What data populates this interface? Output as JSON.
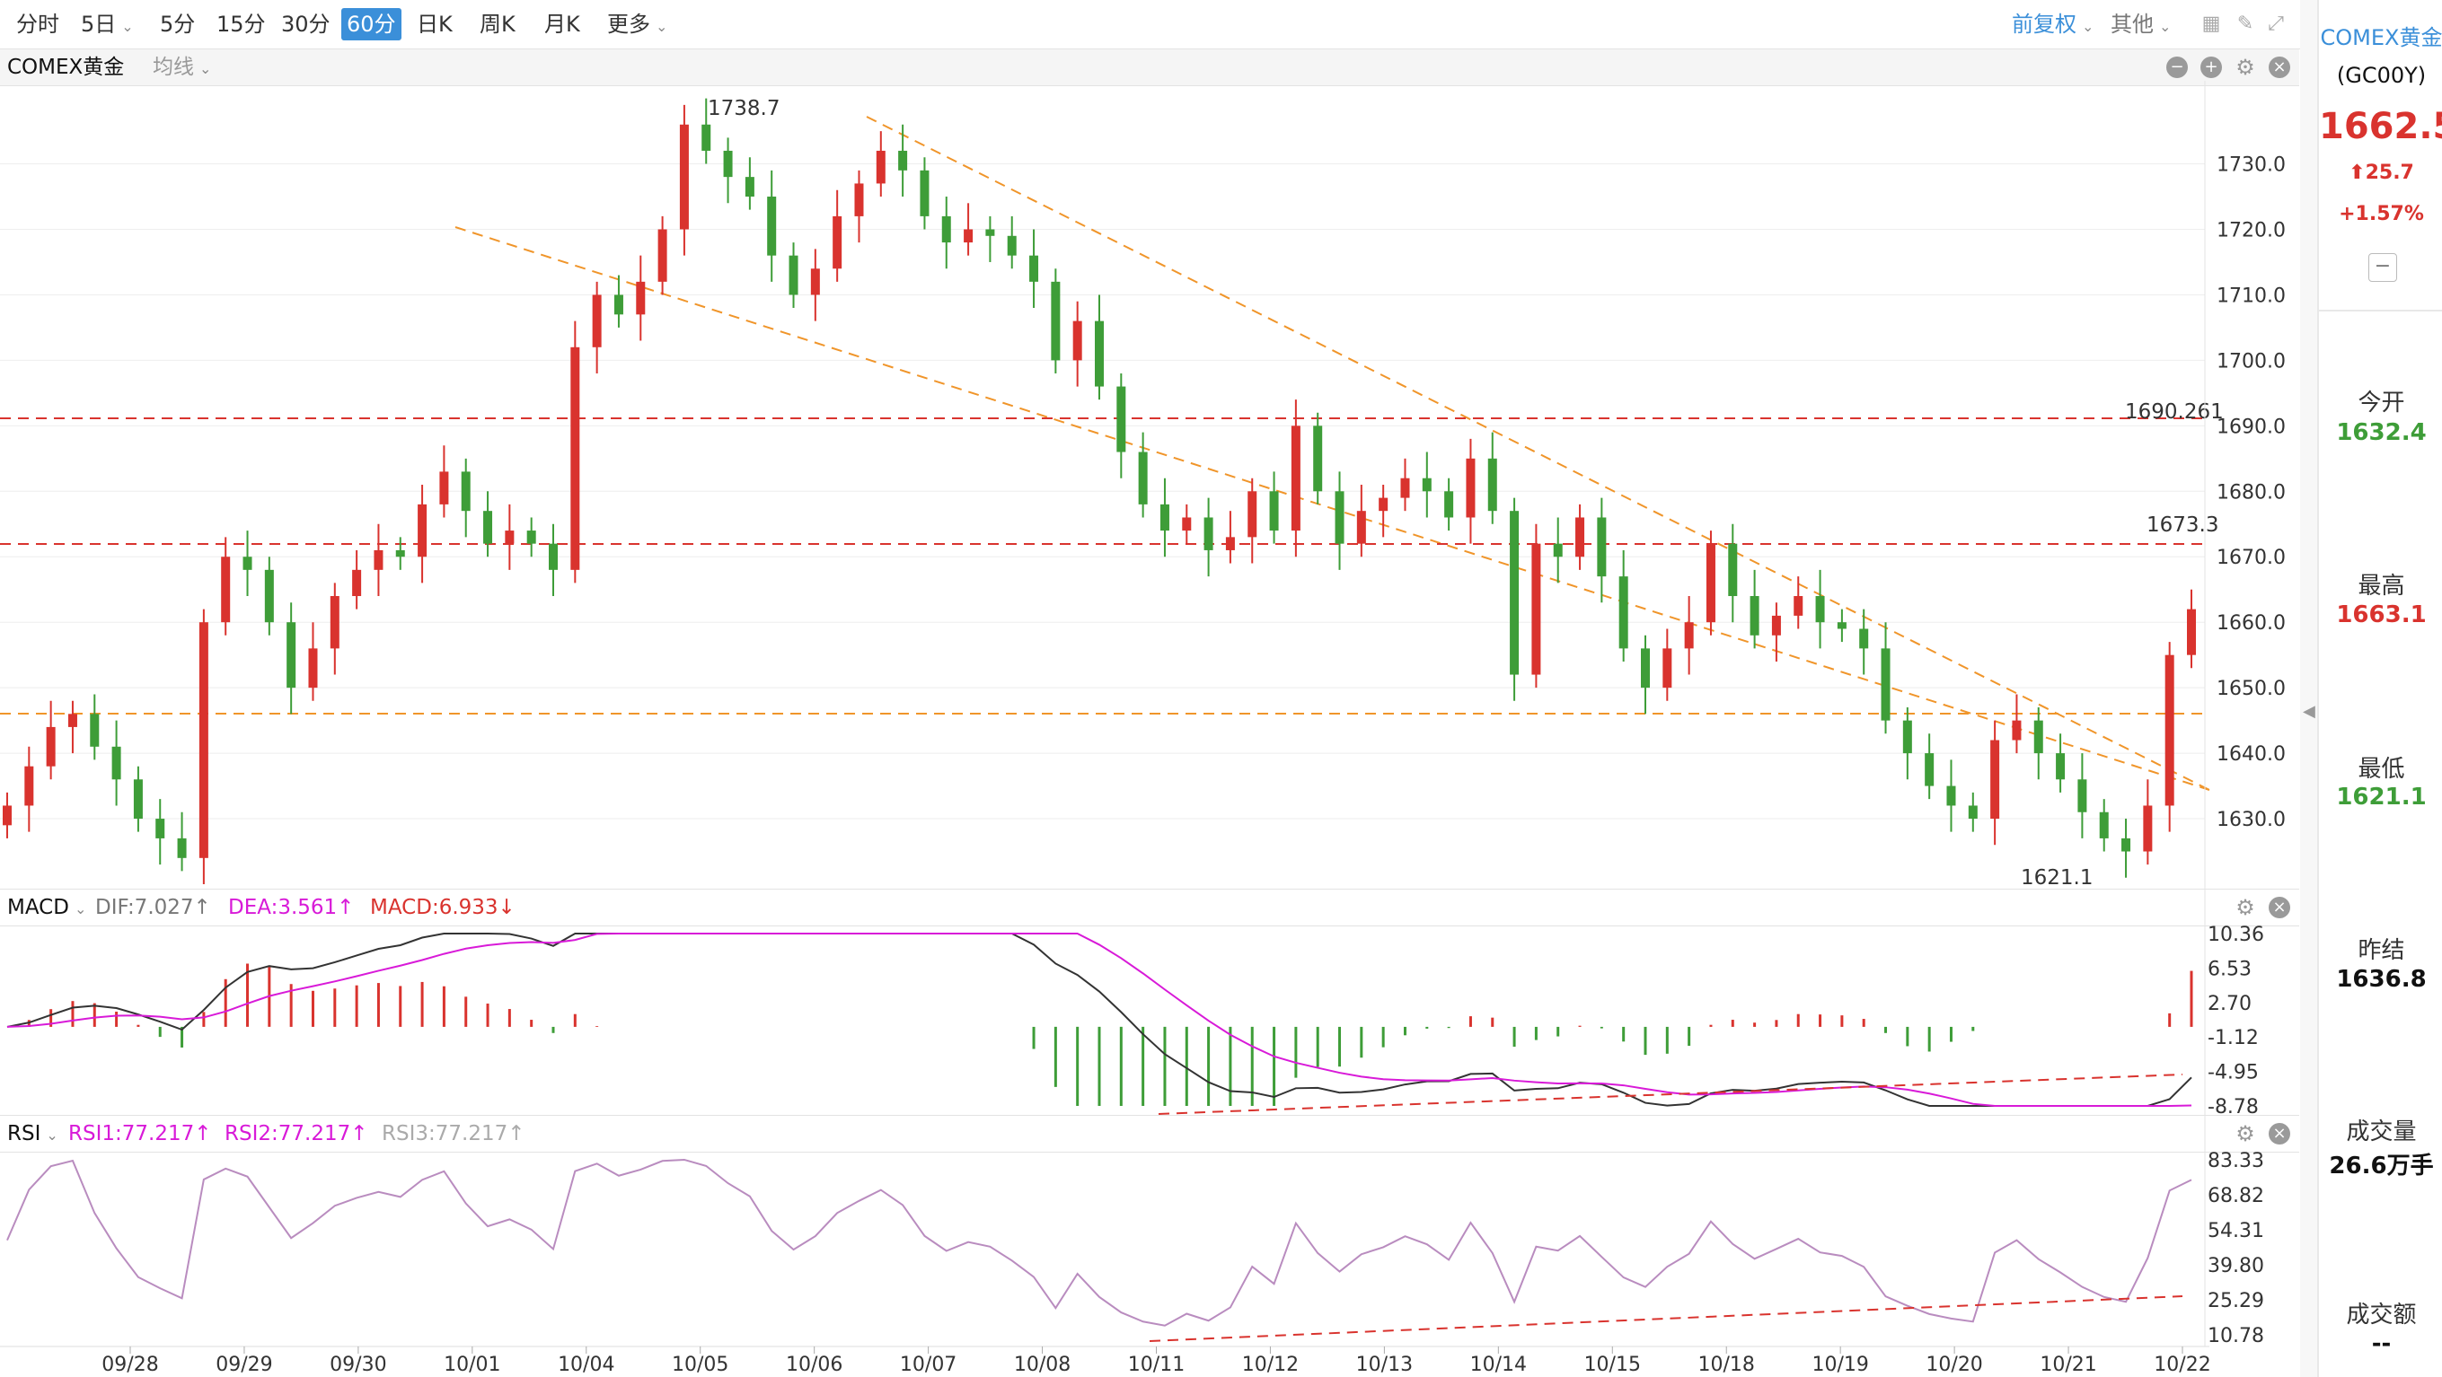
{
  "toolbar": {
    "periods": [
      "分时",
      "5日",
      "5分",
      "15分",
      "30分",
      "60分",
      "日K",
      "周K",
      "月K",
      "更多"
    ],
    "active_period": "60分",
    "right_adjust": "前复权",
    "right_other": "其他"
  },
  "main_panel": {
    "symbol": "COMEX黄金",
    "ma_label": "均线",
    "annotations": [
      "1738.7",
      "1621.1",
      "1690.261",
      "1673.3"
    ],
    "y_ticks": [
      "1730.0",
      "1720.0",
      "1710.0",
      "1700.0",
      "1690.0",
      "1680.0",
      "1670.0",
      "1660.0",
      "1650.0",
      "1640.0",
      "1630.0"
    ]
  },
  "macd_panel": {
    "name": "MACD",
    "dif": "DIF:7.027↑",
    "dea": "DEA:3.561↑",
    "macd": "MACD:6.933↓",
    "y_ticks": [
      "10.36",
      "6.53",
      "2.70",
      "-1.12",
      "-4.95",
      "-8.78"
    ]
  },
  "rsi_panel": {
    "name": "RSI",
    "rsi1": "RSI1:77.217↑",
    "rsi2": "RSI2:77.217↑",
    "rsi3": "RSI3:77.217↑",
    "y_ticks": [
      "83.33",
      "68.82",
      "54.31",
      "39.80",
      "25.29",
      "10.78"
    ]
  },
  "x_axis": [
    "09/28",
    "09/29",
    "09/30",
    "10/01",
    "10/04",
    "10/05",
    "10/06",
    "10/07",
    "10/08",
    "10/11",
    "10/12",
    "10/13",
    "10/14",
    "10/15",
    "10/18",
    "10/19",
    "10/20",
    "10/21",
    "10/22"
  ],
  "info": {
    "name": "COMEX黄金",
    "code": "(GC00Y)",
    "price": "1662.5",
    "change": "25.7",
    "change_pct": "+1.57%",
    "open_label": "今开",
    "open": "1632.4",
    "high_label": "最高",
    "high": "1663.1",
    "low_label": "最低",
    "low": "1621.1",
    "prev_label": "昨结",
    "prev": "1636.8",
    "vol_label": "成交量",
    "vol": "26.6万手",
    "amount_label": "成交额",
    "amount": "--"
  },
  "colors": {
    "up": "#d9332e",
    "down": "#3e9d38",
    "accent": "#3b8fd9",
    "dif": "#333333",
    "dea": "#d81ad8",
    "rsi": "#b98cbf",
    "channel": "#f0952a"
  },
  "chart_data": {
    "type": "candlestick",
    "title": "COMEX黄金 60分",
    "ylim": [
      1620,
      1742
    ],
    "key_levels": {
      "high": 1738.7,
      "low": 1621.1,
      "resistance_1": 1690.261,
      "resistance_2": 1673.3,
      "support": 1647
    },
    "closes": [
      1632,
      1638,
      1644,
      1646,
      1641,
      1636,
      1630,
      1627,
      1624,
      1660,
      1670,
      1668,
      1660,
      1650,
      1656,
      1664,
      1668,
      1671,
      1670,
      1678,
      1683,
      1677,
      1672,
      1674,
      1672,
      1668,
      1702,
      1710,
      1707,
      1712,
      1720,
      1736,
      1732,
      1728,
      1725,
      1716,
      1710,
      1714,
      1722,
      1727,
      1732,
      1729,
      1722,
      1718,
      1720,
      1719,
      1716,
      1712,
      1700,
      1706,
      1696,
      1686,
      1678,
      1674,
      1676,
      1671,
      1673,
      1680,
      1674,
      1690,
      1680,
      1672,
      1677,
      1679,
      1682,
      1680,
      1676,
      1685,
      1677,
      1652,
      1672,
      1670,
      1676,
      1667,
      1656,
      1650,
      1656,
      1660,
      1672,
      1664,
      1658,
      1661,
      1664,
      1660,
      1659,
      1656,
      1645,
      1640,
      1635,
      1632,
      1630,
      1642,
      1645,
      1640,
      1636,
      1631,
      1627,
      1625,
      1632,
      1655,
      1662
    ],
    "macd": {
      "dif_end": 7.027,
      "dea_end": 3.561,
      "macd_end": 6.933,
      "ylim": [
        -8.78,
        10.36
      ]
    },
    "rsi": {
      "rsi1_end": 77.217,
      "ylim": [
        10.78,
        83.33
      ]
    }
  }
}
